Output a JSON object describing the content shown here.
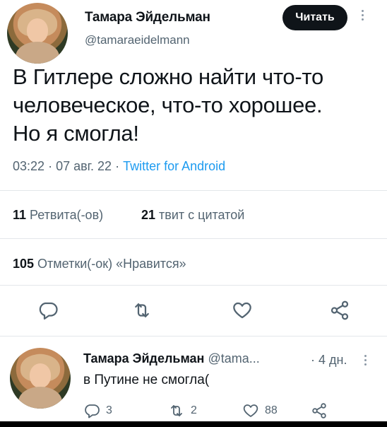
{
  "tweet": {
    "author_name": "Тамара Эйдельман",
    "author_handle": "@tamaraeidelmann",
    "follow_label": "Читать",
    "text_lines": [
      "В Гитлере сложно найти что-то",
      "человеческое, что-то хорошее.",
      "Но я смогла!"
    ],
    "time": "03:22",
    "date": "07 авг. 22",
    "separator": "·",
    "source": "Twitter for Android",
    "retweets_count": "11",
    "retweets_label": "Ретвита(-ов)",
    "quotes_count": "21",
    "quotes_label": "твит с цитатой",
    "likes_count": "105",
    "likes_label": "Отметки(-ок) «Нравится»",
    "icons": [
      "reply-icon",
      "retweet-icon",
      "like-icon",
      "share-icon"
    ]
  },
  "reply": {
    "author_name": "Тамара Эйдельман",
    "author_handle": "@tama...",
    "age": "· 4 дн.",
    "text": "в Путине не смогла(",
    "reply_count": "3",
    "retweet_count": "2",
    "like_count": "88",
    "icons": [
      "reply-icon",
      "retweet-icon",
      "like-icon",
      "share-icon"
    ]
  },
  "colors": {
    "text": "#0f1419",
    "secondary": "#536471",
    "link": "#1d9bf0",
    "button": "#0f1419"
  }
}
